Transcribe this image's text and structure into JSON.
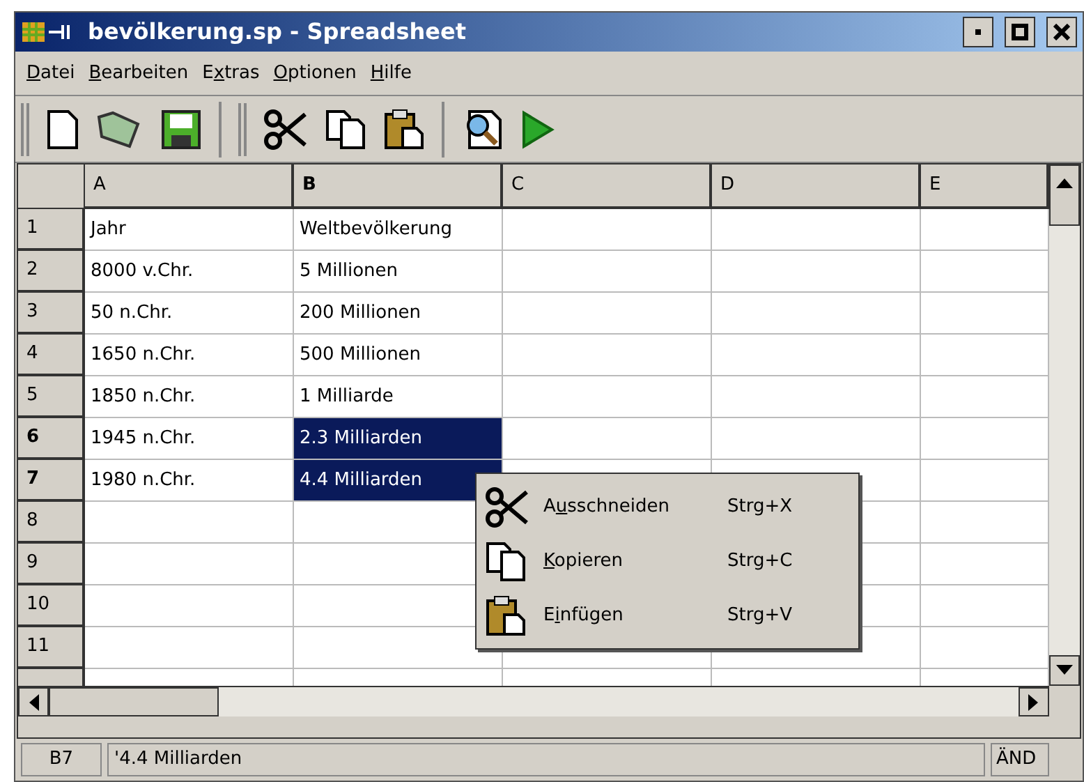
{
  "window": {
    "title": "bevölkerung.sp - Spreadsheet"
  },
  "menu": [
    {
      "key": "D",
      "after": "atei"
    },
    {
      "key": "B",
      "after": "earbeiten"
    },
    {
      "before": "E",
      "key": "x",
      "after": "tras"
    },
    {
      "key": "O",
      "after": "ptionen"
    },
    {
      "key": "H",
      "after": "ilfe"
    }
  ],
  "toolbar": [
    {
      "kind": "grip"
    },
    {
      "kind": "new"
    },
    {
      "kind": "open"
    },
    {
      "kind": "save"
    },
    {
      "kind": "sep"
    },
    {
      "kind": "grip"
    },
    {
      "kind": "cut"
    },
    {
      "kind": "copy"
    },
    {
      "kind": "paste"
    },
    {
      "kind": "sep"
    },
    {
      "kind": "preview"
    },
    {
      "kind": "run"
    }
  ],
  "columns": [
    {
      "label": "A",
      "selected": false
    },
    {
      "label": "B",
      "selected": true
    },
    {
      "label": "C",
      "selected": false
    },
    {
      "label": "D",
      "selected": false
    },
    {
      "label": "E",
      "selected": false
    }
  ],
  "rows": [
    {
      "header": "1",
      "selected": false,
      "cells": [
        {
          "text": "Jahr",
          "selected": false
        },
        {
          "text": "Weltbevölkerung",
          "selected": false
        }
      ]
    },
    {
      "header": "2",
      "selected": false,
      "cells": [
        {
          "text": "8000 v.Chr.",
          "selected": false
        },
        {
          "text": "5 Millionen",
          "selected": false
        }
      ]
    },
    {
      "header": "3",
      "selected": false,
      "cells": [
        {
          "text": "50 n.Chr.",
          "selected": false
        },
        {
          "text": "200 Millionen",
          "selected": false
        }
      ]
    },
    {
      "header": "4",
      "selected": false,
      "cells": [
        {
          "text": "1650 n.Chr.",
          "selected": false
        },
        {
          "text": "500 Millionen",
          "selected": false
        }
      ]
    },
    {
      "header": "5",
      "selected": false,
      "cells": [
        {
          "text": "1850 n.Chr.",
          "selected": false
        },
        {
          "text": "1 Milliarde",
          "selected": false
        }
      ]
    },
    {
      "header": "6",
      "selected": true,
      "cells": [
        {
          "text": "1945 n.Chr.",
          "selected": false
        },
        {
          "text": "2.3 Milliarden",
          "selected": true
        }
      ]
    },
    {
      "header": "7",
      "selected": true,
      "cells": [
        {
          "text": "1980 n.Chr.",
          "selected": false
        },
        {
          "text": "4.4 Milliarden",
          "selected": true
        }
      ]
    },
    {
      "header": "8",
      "selected": false,
      "cells": []
    },
    {
      "header": "9",
      "selected": false,
      "cells": []
    },
    {
      "header": "10",
      "selected": false,
      "cells": []
    },
    {
      "header": "11",
      "selected": false,
      "cells": []
    }
  ],
  "context_menu": [
    {
      "kind": "cut",
      "before": "A",
      "key": "u",
      "after": "sschneiden",
      "shortcut": "Strg+X"
    },
    {
      "kind": "copy",
      "key": "K",
      "after": "opieren",
      "shortcut": "Strg+C"
    },
    {
      "kind": "paste",
      "before": "E",
      "key": "i",
      "after": "nfügen",
      "shortcut": "Strg+V"
    }
  ],
  "status_bar": {
    "cell": "B7",
    "content": "'4.4 Milliarden",
    "mode": "ÄND"
  }
}
